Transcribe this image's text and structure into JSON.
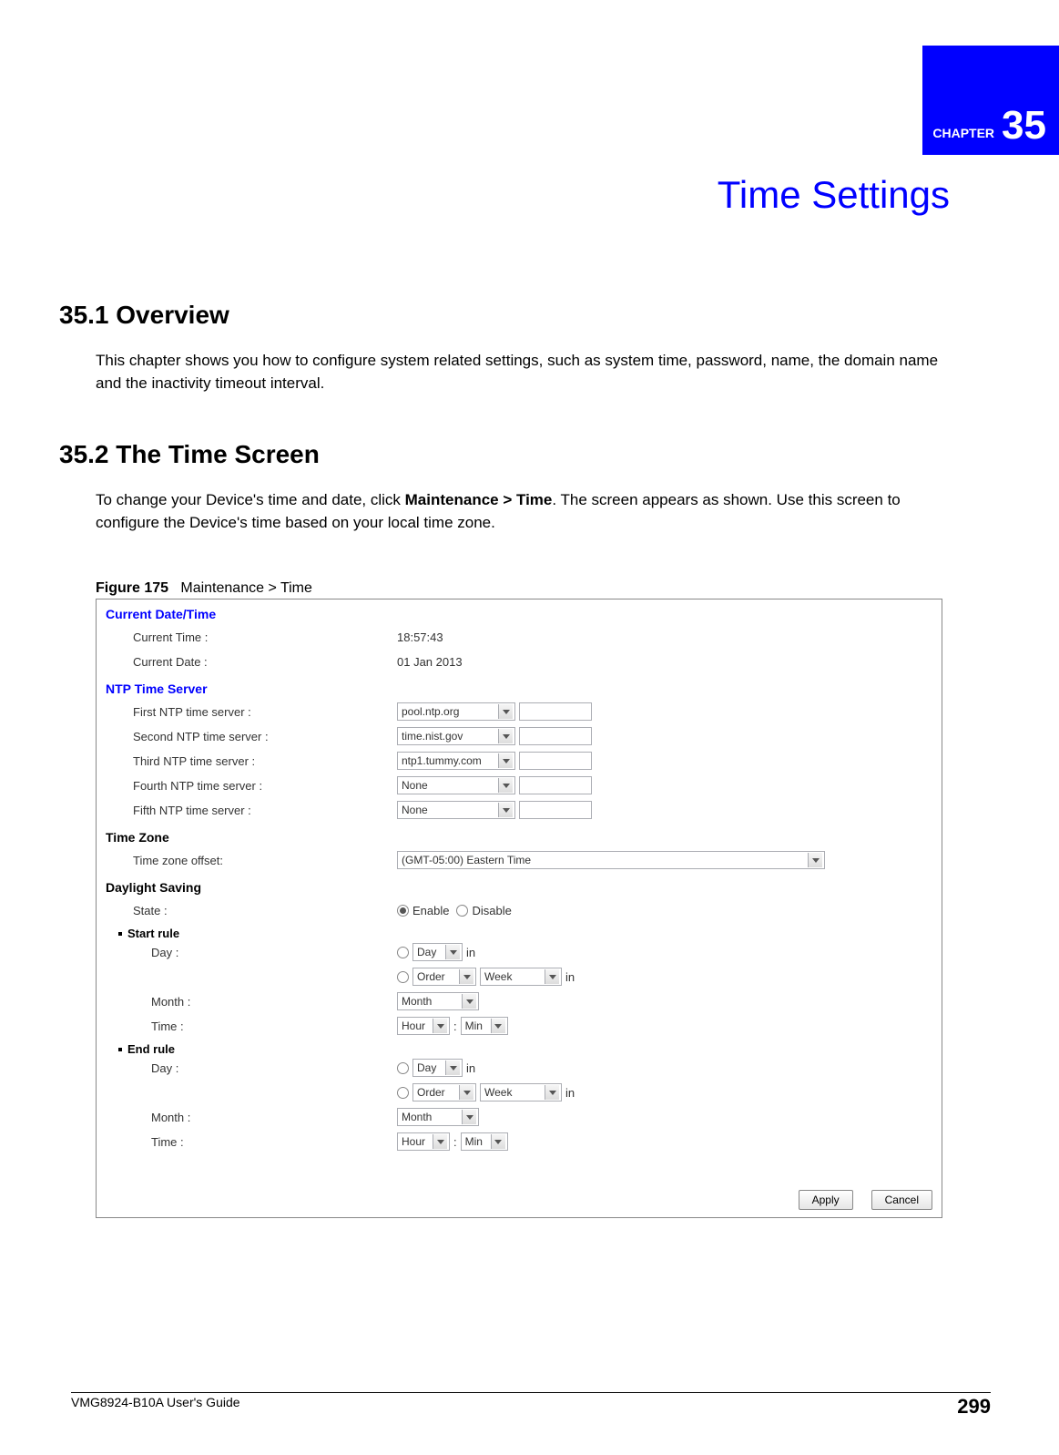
{
  "chapter": {
    "label": "CHAPTER",
    "number": "35",
    "title": "Time Settings"
  },
  "sections": {
    "overview": {
      "heading": "35.1  Overview",
      "text": "This chapter shows you how to configure system related settings, such as system time, password, name, the domain name and the inactivity timeout interval."
    },
    "timescreen": {
      "heading": "35.2  The Time Screen",
      "text_part1": "To change your Device's time and date, click ",
      "text_bold": "Maintenance > Time",
      "text_part2": ". The screen appears as shown. Use this screen to configure the Device's time based on your local time zone."
    }
  },
  "figure": {
    "label": "Figure 175",
    "title": "Maintenance > Time"
  },
  "panel": {
    "cdt": {
      "heading": "Current Date/Time",
      "time_label": "Current Time :",
      "time_value": "18:57:43",
      "date_label": "Current Date :",
      "date_value": "01 Jan 2013"
    },
    "ntp": {
      "heading": "NTP Time Server",
      "first_label": "First NTP time server :",
      "first_value": "pool.ntp.org",
      "second_label": "Second NTP time server :",
      "second_value": "time.nist.gov",
      "third_label": "Third NTP time server :",
      "third_value": "ntp1.tummy.com",
      "fourth_label": "Fourth NTP time server :",
      "fourth_value": "None",
      "fifth_label": "Fifth NTP time server :",
      "fifth_value": "None"
    },
    "tz": {
      "heading": "Time Zone",
      "offset_label": "Time zone offset:",
      "offset_value": "(GMT-05:00) Eastern Time"
    },
    "ds": {
      "heading": "Daylight Saving",
      "state_label": "State :",
      "enable": "Enable",
      "disable": "Disable",
      "start_rule": "Start rule",
      "end_rule": "End rule",
      "day_label": "Day :",
      "month_label": "Month :",
      "time_label": "Time :",
      "dd_day": "Day",
      "dd_order": "Order",
      "dd_week": "Week",
      "dd_month": "Month",
      "dd_hour": "Hour",
      "dd_min": "Min",
      "in": "in",
      "colon": ":"
    },
    "buttons": {
      "apply": "Apply",
      "cancel": "Cancel"
    }
  },
  "footer": {
    "guide": "VMG8924-B10A User's Guide",
    "page": "299"
  }
}
